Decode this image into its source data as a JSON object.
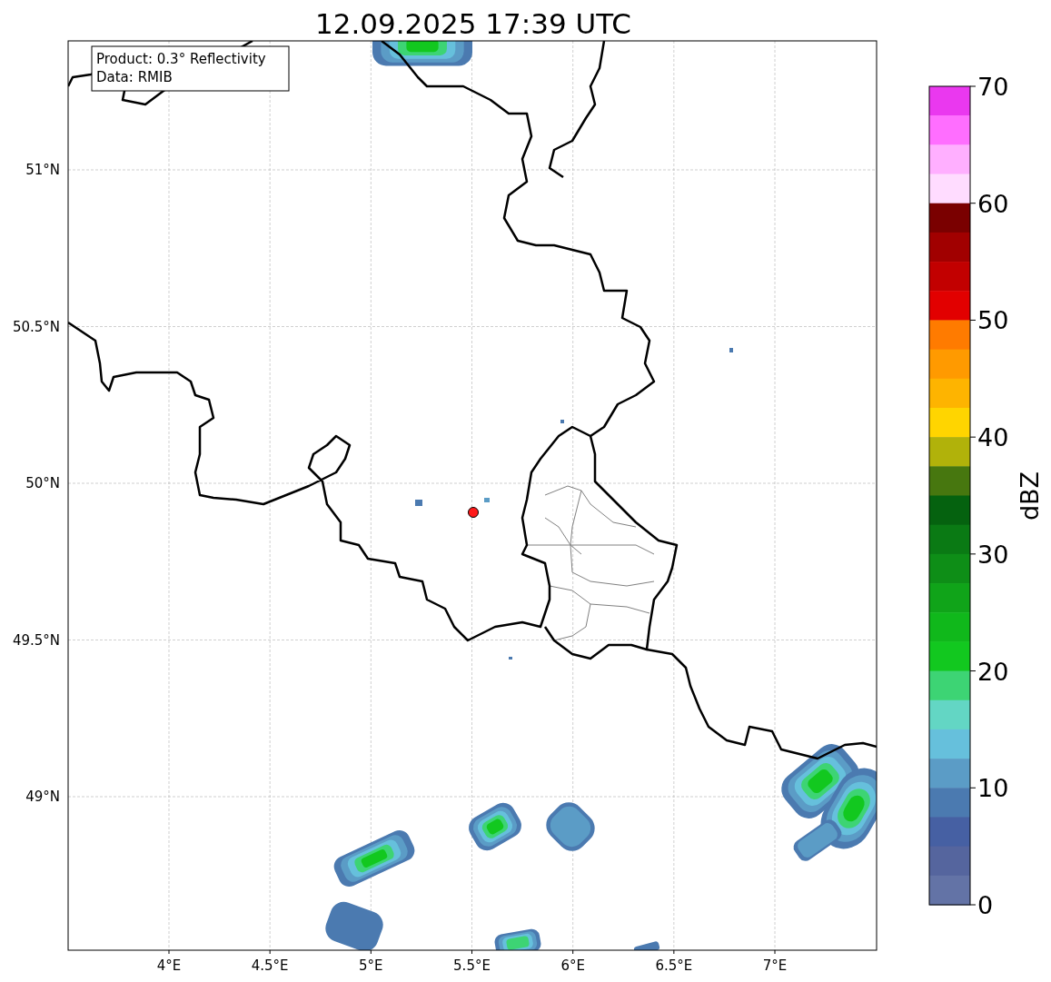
{
  "title": "12.09.2025 17:39 UTC",
  "info_box": {
    "lines": [
      "Product: 0.3° Reflectivity",
      "Data: RMIB"
    ]
  },
  "map": {
    "x_ticks": [
      "4°E",
      "4.5°E",
      "5°E",
      "5.5°E",
      "6°E",
      "6.5°E",
      "7°E"
    ],
    "y_ticks": [
      "51°N",
      "50.5°N",
      "50°N",
      "49.5°N",
      "49°N"
    ]
  },
  "colorbar": {
    "label": "dBZ",
    "ticks": [
      "70",
      "60",
      "50",
      "40",
      "30",
      "20",
      "10",
      "0"
    ],
    "bins": [
      {
        "color": "#ea38ef"
      },
      {
        "color": "#ff6eff"
      },
      {
        "color": "#ffafff"
      },
      {
        "color": "#ffdcff"
      },
      {
        "color": "#7a0000"
      },
      {
        "color": "#a10000"
      },
      {
        "color": "#c20000"
      },
      {
        "color": "#e20000"
      },
      {
        "color": "#ff7b00"
      },
      {
        "color": "#ff9a00"
      },
      {
        "color": "#feb400"
      },
      {
        "color": "#ffd500"
      },
      {
        "color": "#b1b20a"
      },
      {
        "color": "#47770f"
      },
      {
        "color": "#05620f"
      },
      {
        "color": "#0a7a14"
      },
      {
        "color": "#0e8e17"
      },
      {
        "color": "#10a419"
      },
      {
        "color": "#10b81b"
      },
      {
        "color": "#12c81f"
      },
      {
        "color": "#3dd474"
      },
      {
        "color": "#63d6c4"
      },
      {
        "color": "#66c0dc"
      },
      {
        "color": "#5b9cc6"
      },
      {
        "color": "#4b7ab0"
      },
      {
        "color": "#4660a3"
      },
      {
        "color": "#55659e"
      },
      {
        "color": "#6373a6"
      }
    ]
  }
}
